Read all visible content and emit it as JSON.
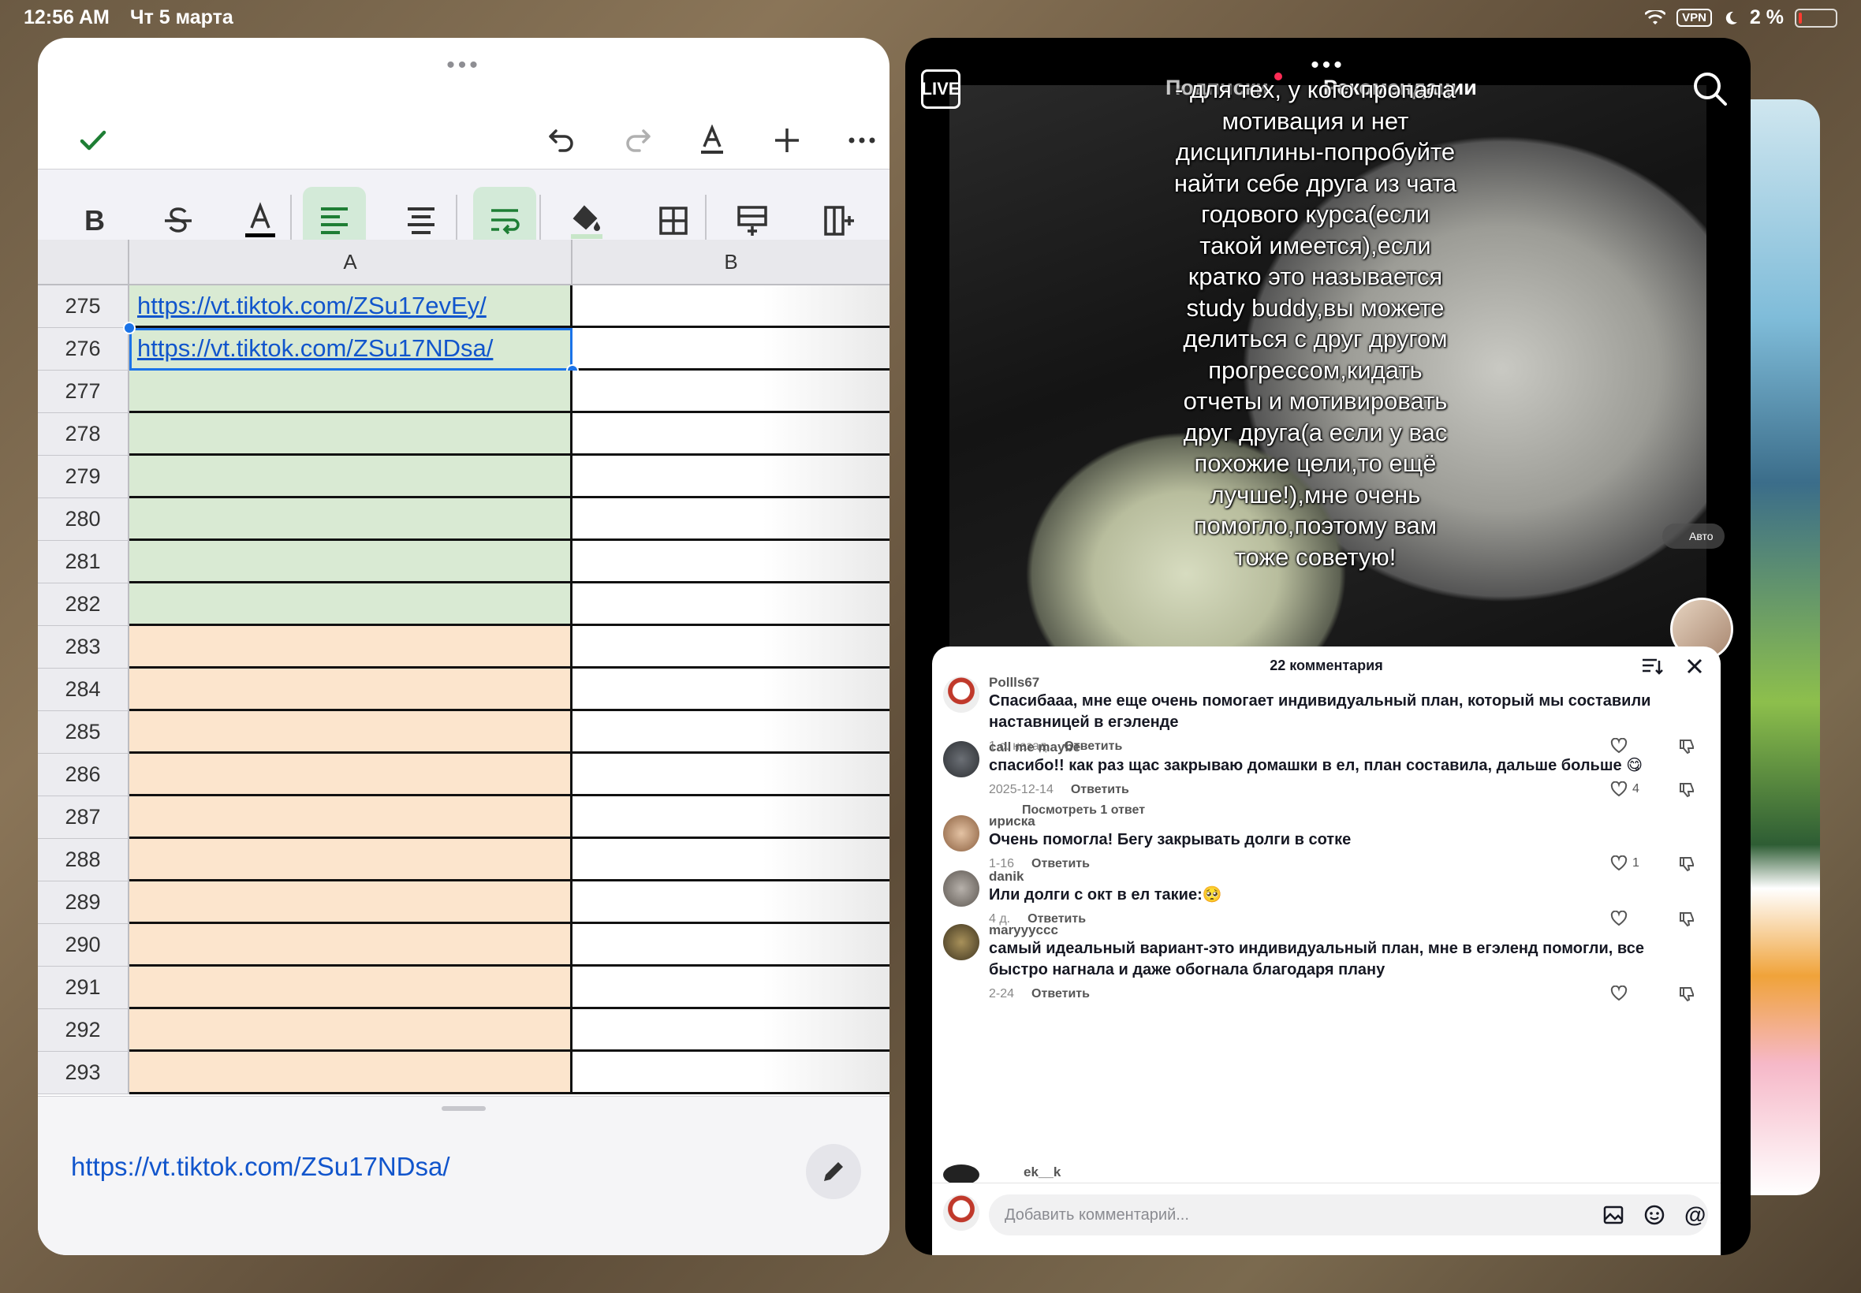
{
  "status_bar": {
    "time": "12:56 AM",
    "date": "Чт 5 марта",
    "vpn": "VPN",
    "battery": "2 %"
  },
  "spreadsheet": {
    "column_headers": [
      "A",
      "B"
    ],
    "rows": [
      {
        "num": "275",
        "a": "https://vt.tiktok.com/ZSu17evEy/",
        "fill": "green"
      },
      {
        "num": "276",
        "a": "https://vt.tiktok.com/ZSu17NDsa/",
        "fill": "green",
        "selected": true
      },
      {
        "num": "277",
        "a": "",
        "fill": "green"
      },
      {
        "num": "278",
        "a": "",
        "fill": "green"
      },
      {
        "num": "279",
        "a": "",
        "fill": "green"
      },
      {
        "num": "280",
        "a": "",
        "fill": "green"
      },
      {
        "num": "281",
        "a": "",
        "fill": "green"
      },
      {
        "num": "282",
        "a": "",
        "fill": "green"
      },
      {
        "num": "283",
        "a": "",
        "fill": "orange"
      },
      {
        "num": "284",
        "a": "",
        "fill": "orange"
      },
      {
        "num": "285",
        "a": "",
        "fill": "orange"
      },
      {
        "num": "286",
        "a": "",
        "fill": "orange"
      },
      {
        "num": "287",
        "a": "",
        "fill": "orange"
      },
      {
        "num": "288",
        "a": "",
        "fill": "orange"
      },
      {
        "num": "289",
        "a": "",
        "fill": "orange"
      },
      {
        "num": "290",
        "a": "",
        "fill": "orange"
      },
      {
        "num": "291",
        "a": "",
        "fill": "orange"
      },
      {
        "num": "292",
        "a": "",
        "fill": "orange"
      },
      {
        "num": "293",
        "a": "",
        "fill": "orange"
      }
    ],
    "edit_value": "https://vt.tiktok.com/ZSu17NDsa/",
    "colors": {
      "green_fill": "#d9ead3",
      "orange_fill": "#fce5cd",
      "accent": "#1e7e34",
      "link": "#1155cc"
    }
  },
  "tiktok": {
    "live_label": "LIVE",
    "tabs": [
      "Подписки",
      "Рекомендации"
    ],
    "caption": "- для тех, у кого пропала\nмотивация и нет\nдисциплины-попробуйте\nнайти себе друга из чата\nгодового курса(если\nтакой имеется),если\nкратко это называется\nstudy buddy,вы можете\nделиться с друг другом\nпрогрессом,кидать\nотчеты и мотивировать\nдруг друга(а если у вас\nпохожие цели,то ещё\nлучше!),мне очень\nпомогло,поэтому вам\nтоже советую!",
    "auto_label": "Авто",
    "comments_title": "22 комментария",
    "comments": [
      {
        "user": "Pollls67",
        "text": "Спасибааа, мне еще очень помогает индивидуальный план, который мы составили наставницей в егэленде",
        "time": "1 с. назад",
        "reply": "Ответить",
        "likes": ""
      },
      {
        "user": "call me maybe",
        "text": "спасибо!! как раз щас закрываю домашки в ел, план составила, дальше больше 😋",
        "time": "2025-12-14",
        "reply": "Ответить",
        "likes": "4",
        "more": "Посмотреть 1 ответ"
      },
      {
        "user": "ириска",
        "text": "Очень помогла! Бегу закрывать долги в сотке",
        "time": "1-16",
        "reply": "Ответить",
        "likes": "1"
      },
      {
        "user": "danik",
        "text": "Или долги с окт в ел такие:🥺",
        "time": "4 д.",
        "reply": "Ответить",
        "likes": ""
      },
      {
        "user": "maryyyccc",
        "text": "самый идеальный вариант-это индивидуальный план, мне в егэленд помогли, все быстро нагнала и даже обогнала благодаря плану",
        "time": "2-24",
        "reply": "Ответить",
        "likes": ""
      }
    ],
    "partial_user": "ek__k",
    "input_placeholder": "Добавить комментарий..."
  }
}
